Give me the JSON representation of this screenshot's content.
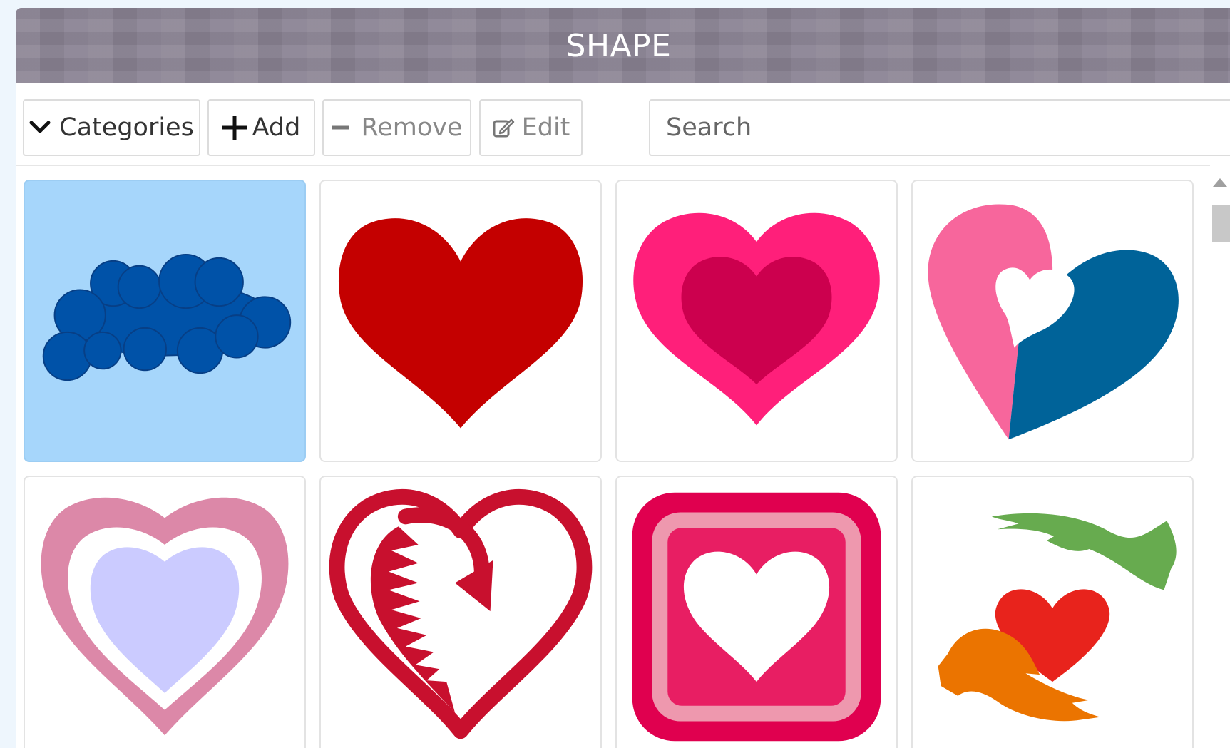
{
  "header": {
    "title": "SHAPE"
  },
  "toolbar": {
    "categories_label": "Categories",
    "add_label": "Add",
    "remove_label": "Remove",
    "edit_label": "Edit",
    "search_placeholder": "Search"
  },
  "colors": {
    "titlebar": "#898292",
    "selected_tile": "#a6d6fb",
    "cloud": "#0052a8",
    "red_heart": "#c40000",
    "pink_outer": "#ff1f7a",
    "pink_inner": "#cc004e",
    "split_pink": "#f7669c",
    "split_blue": "#006399",
    "outline_heart_outer": "#dc88a8",
    "outline_heart_inner": "#cbcbff",
    "arrow_heart": "#c8102e",
    "square_outer": "#e0004f",
    "square_ring": "#ee98ae",
    "square_inner": "#e81e63",
    "hands_green": "#67ab4f",
    "hands_orange": "#eb7400",
    "hands_heart": "#e8231c"
  },
  "shapes": [
    {
      "name": "cloud",
      "selected": true
    },
    {
      "name": "red-heart",
      "selected": false
    },
    {
      "name": "pink-double-heart",
      "selected": false
    },
    {
      "name": "pink-blue-split-heart",
      "selected": false
    },
    {
      "name": "outlined-lavender-heart",
      "selected": false
    },
    {
      "name": "arrow-heart",
      "selected": false
    },
    {
      "name": "heart-in-square",
      "selected": false
    },
    {
      "name": "hands-holding-heart",
      "selected": false
    }
  ]
}
